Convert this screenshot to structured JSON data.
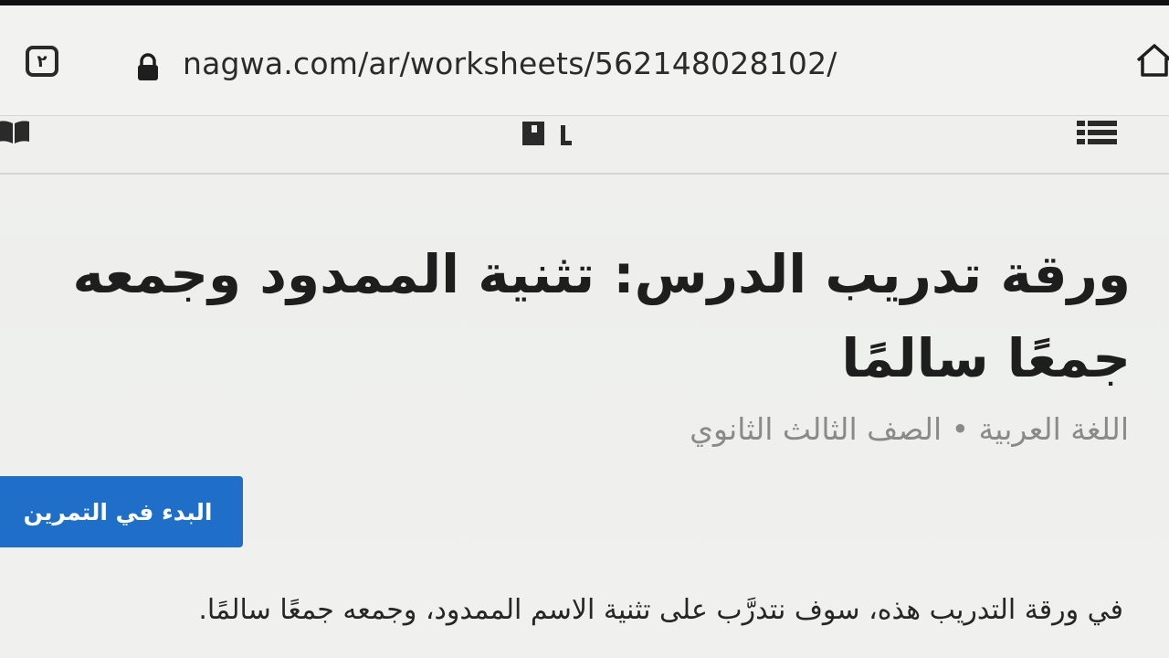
{
  "browser": {
    "tab_count": "٢",
    "url": "nagwa.com/ar/worksheets/562148028102/"
  },
  "toolbar": {
    "left_icon": "book-icon",
    "center_icon": "nagwa-logo-icon",
    "right_icon": "menu-icon"
  },
  "worksheet": {
    "title": "ورقة تدريب الدرس: تثنية الممدود وجمعه جمعًا سالمًا",
    "subject_line": "اللغة العربية • الصف الثالث الثانوي",
    "start_button_label": "البدء في التمرين",
    "description": "في ورقة التدريب هذه، سوف نتدرَّب على تثنية الاسم الممدود، وجمعه جمعًا سالمًا."
  },
  "colors": {
    "accent": "#1f6fc9",
    "text_primary": "#1e1e1e",
    "text_muted": "#8a8a8a"
  }
}
